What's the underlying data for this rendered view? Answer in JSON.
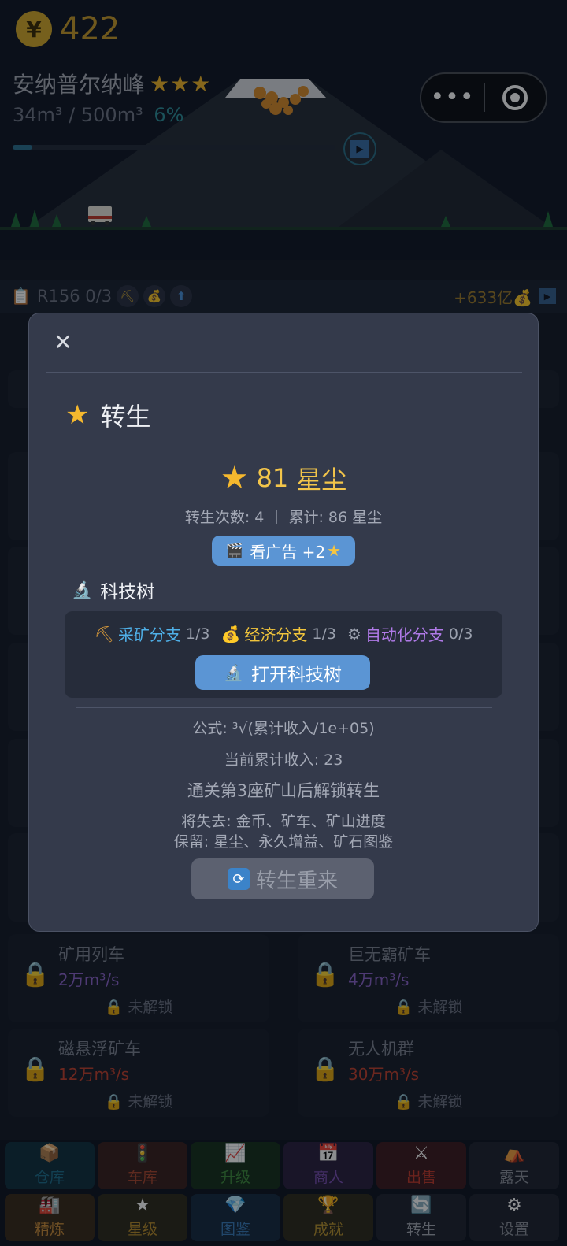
{
  "hud": {
    "coin_symbol": "¥",
    "coins": "422",
    "mine_name": "安纳普尔纳峰",
    "mine_stars": "★★★",
    "mine_progress": "34m³ / 500m³",
    "mine_percent": "6%",
    "mine_progress_fraction": 0.06,
    "play_symbol": "▶"
  },
  "mini_program_capsule": {
    "more_symbol": "•••"
  },
  "info_bar": {
    "clip_icon": "clipboard-icon",
    "round_text": "R156 0/3",
    "chip_icons": [
      "pickaxe-icon",
      "money-bag-icon",
      "upgrade-arrow-icon"
    ],
    "income_text": "+633亿💰",
    "play_symbol": "▶"
  },
  "vehicles": [
    {
      "name": "矿用列车",
      "rate": "2万m³/s",
      "rate_color": "#8a63c9",
      "status": "🔒 未解锁"
    },
    {
      "name": "巨无霸矿车",
      "rate": "4万m³/s",
      "rate_color": "#8a63c9",
      "status": "🔒 未解锁"
    },
    {
      "name": "磁悬浮矿车",
      "rate": "12万m³/s",
      "rate_color": "#c0402e",
      "status": "🔒 未解锁"
    },
    {
      "name": "无人机群",
      "rate": "30万m³/s",
      "rate_color": "#c0402e",
      "status": "🔒 未解锁"
    }
  ],
  "bottom_nav": {
    "row1": [
      {
        "label": "仓库",
        "icon": "📦",
        "color": "#1e6d8a",
        "bg": "#12303f"
      },
      {
        "label": "车库",
        "icon": "🚦",
        "color": "#a8462e",
        "bg": "#3a1f1e"
      },
      {
        "label": "升级",
        "icon": "📈",
        "color": "#3f8a3c",
        "bg": "#16301c"
      },
      {
        "label": "商人",
        "icon": "📅",
        "color": "#7a4fb3",
        "bg": "#2a1f3f"
      },
      {
        "label": "出售",
        "icon": "⚔",
        "color": "#c0392b",
        "bg": "#3c1a1f"
      },
      {
        "label": "露天",
        "icon": "⛺",
        "color": "#8b8f9a",
        "bg": "#1f2430"
      }
    ],
    "row2": [
      {
        "label": "精炼",
        "icon": "🏭",
        "color": "#c98a3a",
        "bg": "#3a2a1a"
      },
      {
        "label": "星级",
        "icon": "★",
        "color": "#b78a2a",
        "bg": "#2f2a1c"
      },
      {
        "label": "图鉴",
        "icon": "💎",
        "color": "#3a7ab8",
        "bg": "#172a40"
      },
      {
        "label": "成就",
        "icon": "🏆",
        "color": "#b8932e",
        "bg": "#2f2a1c"
      },
      {
        "label": "转生",
        "icon": "🔄",
        "color": "#a4a8b2",
        "bg": "#1f2430"
      },
      {
        "label": "设置",
        "icon": "⚙",
        "color": "#8b8f9a",
        "bg": "#1f2430"
      }
    ]
  },
  "modal": {
    "close_symbol": "✕",
    "title_icon": "★",
    "title": "转生",
    "stardust_icon": "★",
    "stardust_value": "81",
    "stardust_unit": "星尘",
    "rebirth_stats": "转生次数: 4 丨 累计: 86 星尘",
    "ad_button": {
      "icon": "🎬",
      "label": "看广告 +2",
      "star": "★"
    },
    "tech_heading": "科技树",
    "tech_heading_icon": "🔬",
    "branches": [
      {
        "icon": "⛏",
        "name": "采矿分支",
        "progress": "1/3",
        "color": "#4fb0e8"
      },
      {
        "icon": "💰",
        "name": "经济分支",
        "progress": "1/3",
        "color": "#f0c43c"
      },
      {
        "icon": "⚙",
        "name": "自动化分支",
        "progress": "0/3",
        "color": "#b07ae8"
      }
    ],
    "open_tree_button": {
      "icon": "🔬",
      "label": "打开科技树"
    },
    "formula": "公式: ³√(累计收入/1e+05)",
    "current_income": "当前累计收入: 23",
    "unlock_hint": "通关第3座矿山后解锁转生",
    "lose_line": "将失去: 金币、矿车、矿山进度",
    "keep_line": "保留: 星尘、永久增益、矿石图鉴",
    "rebirth_button": {
      "icon": "🔄",
      "label": "转生重来"
    }
  }
}
